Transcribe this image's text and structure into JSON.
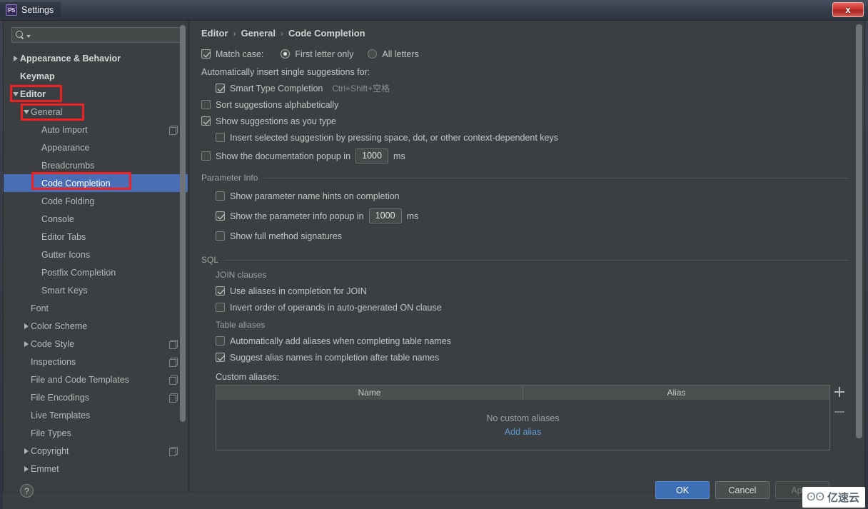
{
  "window": {
    "title": "Settings",
    "app_icon": "phpstorm-icon",
    "close_label": "x"
  },
  "sidebar": {
    "search": {
      "value": "",
      "placeholder": ""
    },
    "items": [
      {
        "label": "Appearance & Behavior",
        "arrow": "right",
        "depth": 0,
        "bold": true,
        "copy": false,
        "selected": false
      },
      {
        "label": "Keymap",
        "arrow": "none",
        "depth": 0,
        "bold": true,
        "copy": false,
        "selected": false
      },
      {
        "label": "Editor",
        "arrow": "down",
        "depth": 0,
        "bold": true,
        "copy": false,
        "selected": false
      },
      {
        "label": "General",
        "arrow": "down",
        "depth": 1,
        "bold": false,
        "copy": false,
        "selected": false
      },
      {
        "label": "Auto Import",
        "arrow": "none",
        "depth": 2,
        "bold": false,
        "copy": true,
        "selected": false
      },
      {
        "label": "Appearance",
        "arrow": "none",
        "depth": 2,
        "bold": false,
        "copy": false,
        "selected": false
      },
      {
        "label": "Breadcrumbs",
        "arrow": "none",
        "depth": 2,
        "bold": false,
        "copy": false,
        "selected": false
      },
      {
        "label": "Code Completion",
        "arrow": "none",
        "depth": 2,
        "bold": false,
        "copy": false,
        "selected": true
      },
      {
        "label": "Code Folding",
        "arrow": "none",
        "depth": 2,
        "bold": false,
        "copy": false,
        "selected": false
      },
      {
        "label": "Console",
        "arrow": "none",
        "depth": 2,
        "bold": false,
        "copy": false,
        "selected": false
      },
      {
        "label": "Editor Tabs",
        "arrow": "none",
        "depth": 2,
        "bold": false,
        "copy": false,
        "selected": false
      },
      {
        "label": "Gutter Icons",
        "arrow": "none",
        "depth": 2,
        "bold": false,
        "copy": false,
        "selected": false
      },
      {
        "label": "Postfix Completion",
        "arrow": "none",
        "depth": 2,
        "bold": false,
        "copy": false,
        "selected": false
      },
      {
        "label": "Smart Keys",
        "arrow": "none",
        "depth": 2,
        "bold": false,
        "copy": false,
        "selected": false
      },
      {
        "label": "Font",
        "arrow": "none",
        "depth": 1,
        "bold": false,
        "copy": false,
        "selected": false
      },
      {
        "label": "Color Scheme",
        "arrow": "right",
        "depth": 1,
        "bold": false,
        "copy": false,
        "selected": false
      },
      {
        "label": "Code Style",
        "arrow": "right",
        "depth": 1,
        "bold": false,
        "copy": true,
        "selected": false
      },
      {
        "label": "Inspections",
        "arrow": "none",
        "depth": 1,
        "bold": false,
        "copy": true,
        "selected": false
      },
      {
        "label": "File and Code Templates",
        "arrow": "none",
        "depth": 1,
        "bold": false,
        "copy": true,
        "selected": false
      },
      {
        "label": "File Encodings",
        "arrow": "none",
        "depth": 1,
        "bold": false,
        "copy": true,
        "selected": false
      },
      {
        "label": "Live Templates",
        "arrow": "none",
        "depth": 1,
        "bold": false,
        "copy": false,
        "selected": false
      },
      {
        "label": "File Types",
        "arrow": "none",
        "depth": 1,
        "bold": false,
        "copy": false,
        "selected": false
      },
      {
        "label": "Copyright",
        "arrow": "right",
        "depth": 1,
        "bold": false,
        "copy": true,
        "selected": false
      },
      {
        "label": "Emmet",
        "arrow": "right",
        "depth": 1,
        "bold": false,
        "copy": false,
        "selected": false
      }
    ]
  },
  "breadcrumb": {
    "part1": "Editor",
    "sep1": "›",
    "part2": "General",
    "sep2": "›",
    "part3": "Code Completion"
  },
  "main": {
    "match_case_label": "Match case:",
    "match_case_checked": true,
    "radio_first_letter": "First letter only",
    "radio_all_letters": "All letters",
    "radio_selected": "first",
    "auto_insert_header": "Automatically insert single suggestions for:",
    "smart_type_label": "Smart Type Completion",
    "smart_type_shortcut": "Ctrl+Shift+空格",
    "smart_type_checked": true,
    "sort_alpha_label": "Sort suggestions alphabetically",
    "sort_alpha_checked": false,
    "show_as_type_label": "Show suggestions as you type",
    "show_as_type_checked": true,
    "insert_selected_label": "Insert selected suggestion by pressing space, dot, or other context-dependent keys",
    "insert_selected_checked": false,
    "doc_popup_label": "Show the documentation popup in",
    "doc_popup_checked": false,
    "doc_popup_value": "1000",
    "doc_popup_unit": "ms"
  },
  "parameter_info": {
    "section_title": "Parameter Info",
    "hints_label": "Show parameter name hints on completion",
    "hints_checked": false,
    "popup_label": "Show the parameter info popup in",
    "popup_checked": true,
    "popup_value": "1000",
    "popup_unit": "ms",
    "full_sig_label": "Show full method signatures",
    "full_sig_checked": false
  },
  "sql": {
    "section_title": "SQL",
    "join_group": "JOIN clauses",
    "use_aliases_label": "Use aliases in completion for JOIN",
    "use_aliases_checked": true,
    "invert_order_label": "Invert order of operands in auto-generated ON clause",
    "invert_order_checked": false,
    "table_aliases_group": "Table aliases",
    "auto_add_label": "Automatically add aliases when completing table names",
    "auto_add_checked": false,
    "suggest_alias_label": "Suggest alias names in completion after table names",
    "suggest_alias_checked": true,
    "custom_aliases_label": "Custom aliases:",
    "col_name": "Name",
    "col_alias": "Alias",
    "empty_text": "No custom aliases",
    "add_link": "Add alias",
    "add_button": "+",
    "remove_button": "−"
  },
  "buttons": {
    "help": "?",
    "ok": "OK",
    "cancel": "Cancel",
    "apply": "Apply"
  },
  "watermark": {
    "logo": "ʘʘ",
    "text": "亿速云"
  },
  "colors": {
    "accent_blue": "#4a6eb5",
    "selection_blue": "#3d6fb5",
    "link_blue": "#5b9ad8",
    "annotation_red": "#ee2222",
    "panel_bg": "#3c3f41",
    "close_red": "#c8302a"
  }
}
